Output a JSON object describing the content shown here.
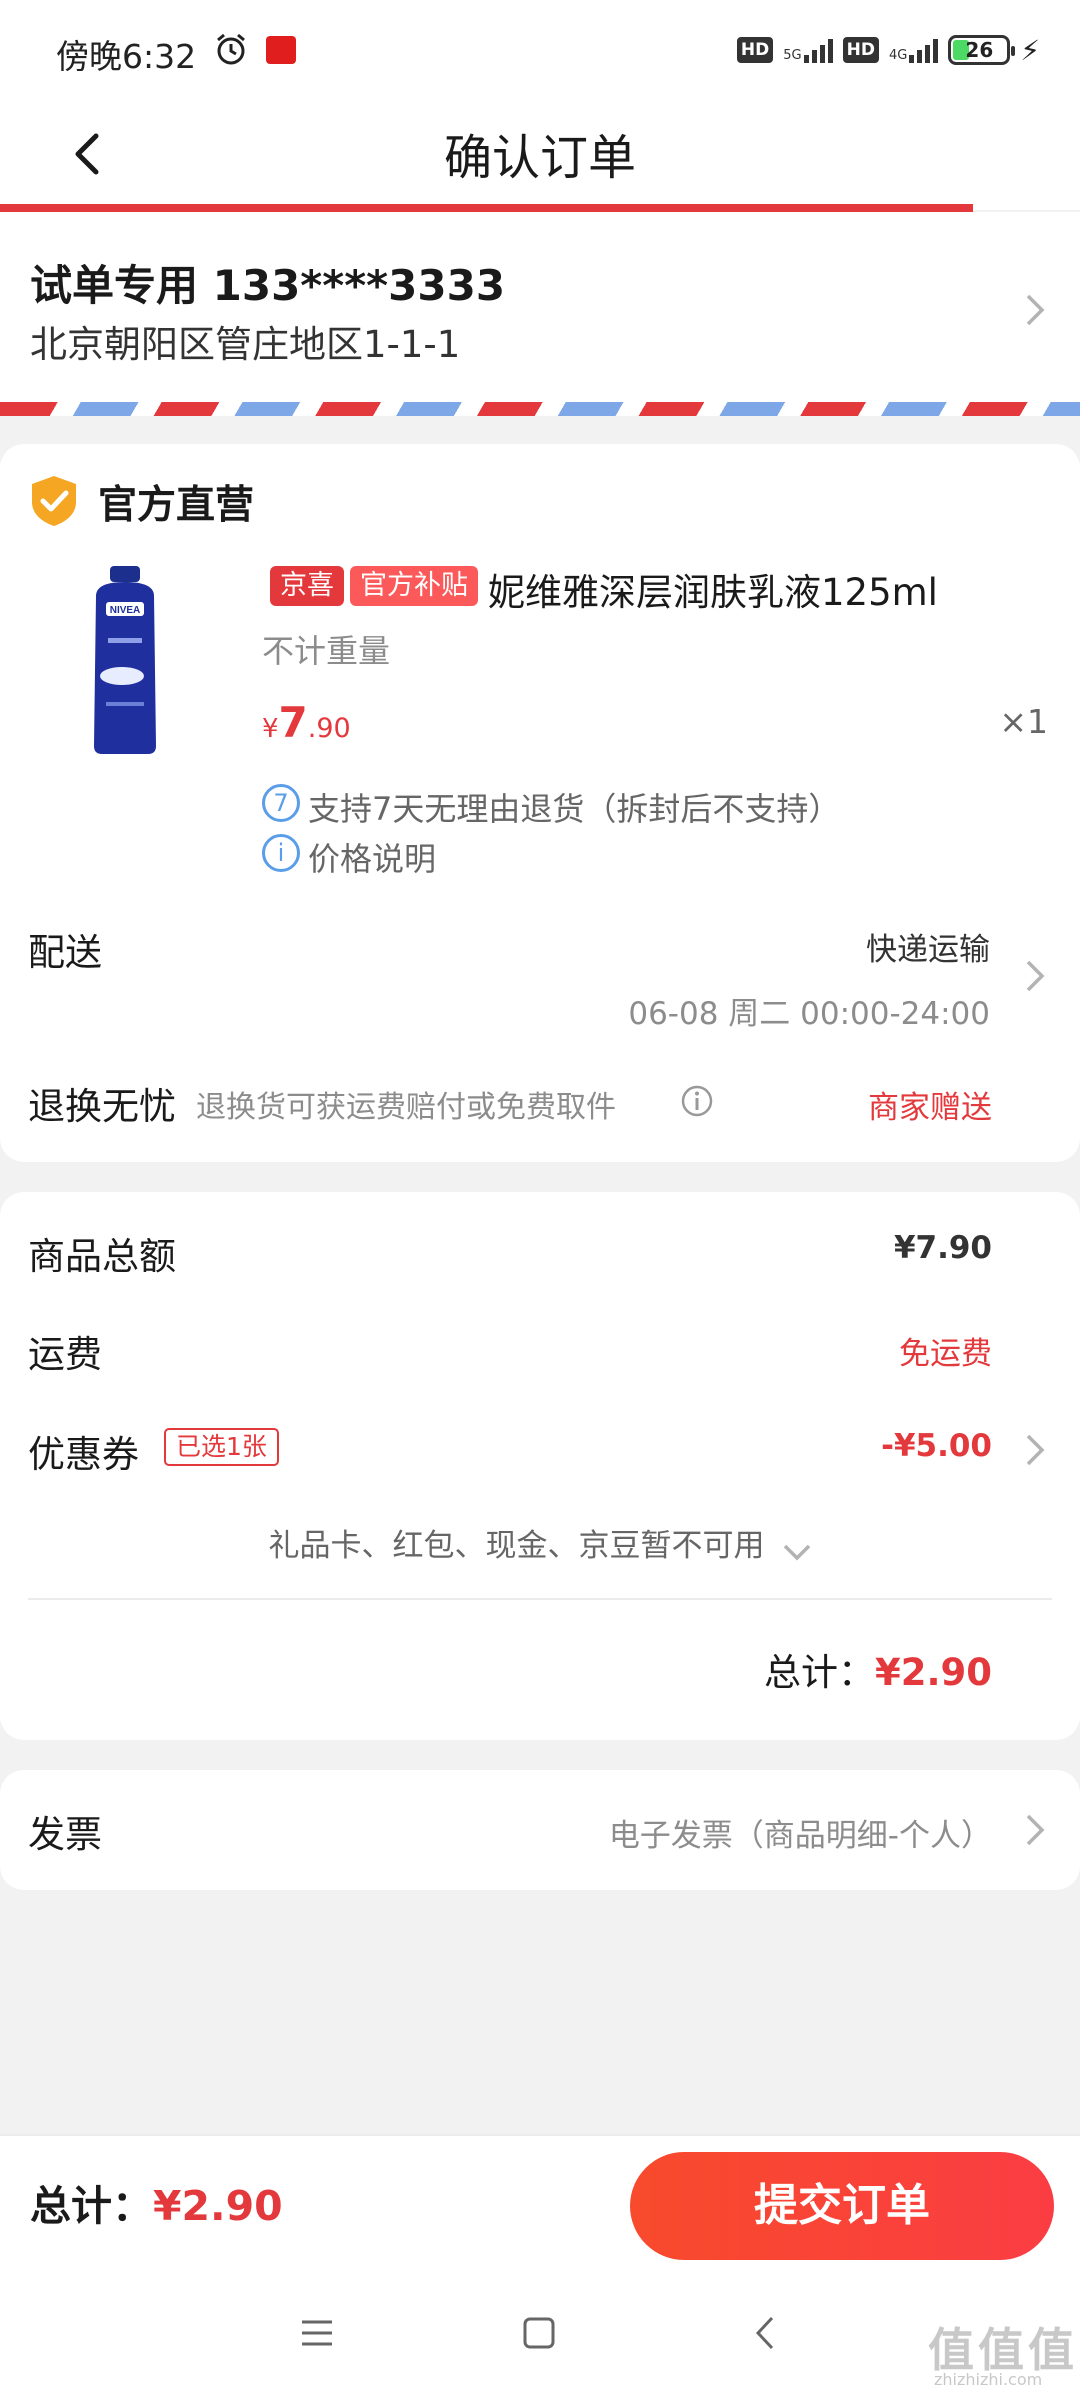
{
  "status_bar": {
    "time": "傍晚6:32",
    "hd1": "HD",
    "net1": "5G",
    "hd2": "HD",
    "net2": "4G",
    "battery": "26"
  },
  "nav": {
    "title": "确认订单"
  },
  "address": {
    "name_phone": "试单专用 133****3333",
    "detail": "北京朝阳区管庄地区1-1-1"
  },
  "shop": {
    "name": "官方直营"
  },
  "product": {
    "tag1": "京喜",
    "tag2": "官方补贴",
    "title": "妮维雅深层润肤乳液125ml",
    "weight": "不计重量",
    "price_symbol": "¥",
    "price_int": "7",
    "price_dec": ".90",
    "quantity": "×1",
    "service1_icon": "7",
    "service1": "支持7天无理由退货（拆封后不支持）",
    "service2_icon": "i",
    "service2": "价格说明"
  },
  "delivery": {
    "label": "配送",
    "method": "快递运输",
    "time": "06-08 周二 00:00-24:00"
  },
  "return_service": {
    "label": "退换无忧",
    "desc": "退换货可获运费赔付或免费取件",
    "value": "商家赠送"
  },
  "summary": {
    "goods_label": "商品总额",
    "goods_value": "¥7.90",
    "shipping_label": "运费",
    "shipping_value": "免运费",
    "coupon_label": "优惠券",
    "coupon_tag": "已选1张",
    "coupon_value": "-¥5.00",
    "unavailable": "礼品卡、红包、现金、京豆暂不可用",
    "total_label": "总计：",
    "total_value": "¥2.90"
  },
  "invoice": {
    "label": "发票",
    "value": "电子发票（商品明细-个人）"
  },
  "bottom_bar": {
    "total_label": "总计：",
    "total_value": "¥2.90",
    "submit": "提交订单"
  },
  "watermark": {
    "text": "值值值",
    "url": "zhizhizhi.com"
  },
  "colors": {
    "accent": "#e4393c",
    "link_blue": "#5a9de8"
  }
}
